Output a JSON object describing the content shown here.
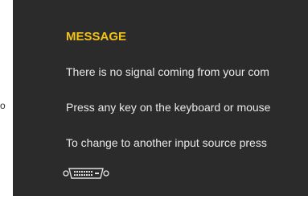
{
  "side_text": "o",
  "osd": {
    "title": "MESSAGE",
    "lines": [
      "There is no signal coming from your com",
      "Press any key on the keyboard or mouse",
      "To change to another input source press"
    ],
    "connector_icon": "dvi-connector-icon"
  },
  "colors": {
    "panel_background": "#2b2b2b",
    "title": "#f2c318",
    "text": "#e8e8e8"
  }
}
